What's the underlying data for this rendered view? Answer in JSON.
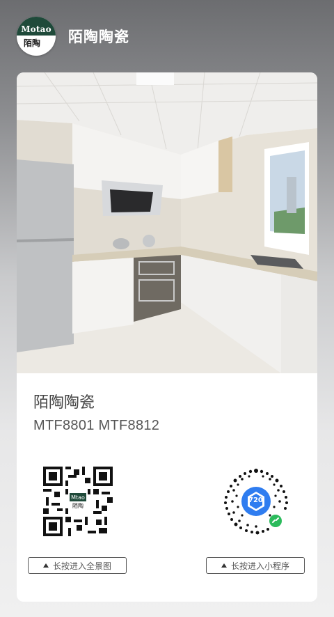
{
  "header": {
    "logo_text_en": "Motao",
    "logo_text_cn": "陌陶",
    "logo_text_cn_small": "陌陶\n陶瓷",
    "title": "陌陶陶瓷"
  },
  "card": {
    "company": "陌陶陶瓷",
    "models": "MTF8801 MTF8812",
    "qr_left_hint": "长按进入全景图",
    "qr_right_hint": "长按进入小程序",
    "mini_program_badge": "720"
  },
  "colors": {
    "logo_green": "#1f4a3a",
    "mini_program_blue": "#2f7df0",
    "wechat_green": "#2bbb5c"
  },
  "icons": {
    "hint_arrow": "triangle-up-icon",
    "mini_program": "link-icon"
  }
}
